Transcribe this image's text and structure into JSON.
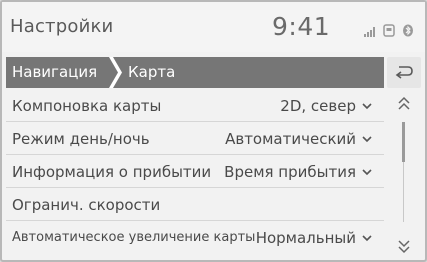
{
  "header": {
    "title": "Настройки",
    "clock": "9:41",
    "status_icons": [
      "signal-icon",
      "wifi-icon",
      "bluetooth-icon"
    ]
  },
  "breadcrumb": {
    "items": [
      {
        "label": "Навигация"
      },
      {
        "label": "Карта"
      }
    ]
  },
  "back_button": {
    "icon": "back-arrow-icon"
  },
  "settings": [
    {
      "label": "Компоновка карты",
      "value": "2D, север"
    },
    {
      "label": "Режим день/ночь",
      "value": "Автоматический"
    },
    {
      "label": "Информация о прибытии",
      "value": "Время прибытия"
    },
    {
      "label": "Огранич. скорости",
      "value": ""
    },
    {
      "label": "Автоматическое увеличение карты",
      "value": "Нормальный"
    }
  ],
  "scroll": {
    "up_icon": "double-chevron-up-icon",
    "down_icon": "double-chevron-down-icon"
  },
  "colors": {
    "breadcrumb_bg": "#767676",
    "screen_bg": "#f2f2f2",
    "text": "#4a4a4a"
  }
}
